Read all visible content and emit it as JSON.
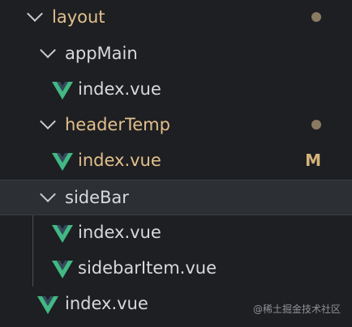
{
  "explorer": {
    "layout": {
      "label": "layout"
    },
    "appMain": {
      "label": "appMain"
    },
    "appMain_index": {
      "label": "index.vue"
    },
    "headerTemp": {
      "label": "headerTemp"
    },
    "headerTemp_index": {
      "label": "index.vue",
      "badge": "M"
    },
    "sideBar": {
      "label": "sideBar"
    },
    "sideBar_index": {
      "label": "index.vue"
    },
    "sideBar_item": {
      "label": "sidebarItem.vue"
    },
    "layout_index": {
      "label": "index.vue"
    }
  },
  "watermark": "@稀土掘金技术社区",
  "colors": {
    "background": "#1e1f22",
    "modified": "#e2c08d",
    "vue_green": "#42b883",
    "vue_dark": "#35495e",
    "dot": "#8b7a62"
  },
  "icons": {
    "folder_toggle": "chevron-down-icon",
    "vue_file": "vue-icon",
    "modified_dot": "dot-icon"
  }
}
